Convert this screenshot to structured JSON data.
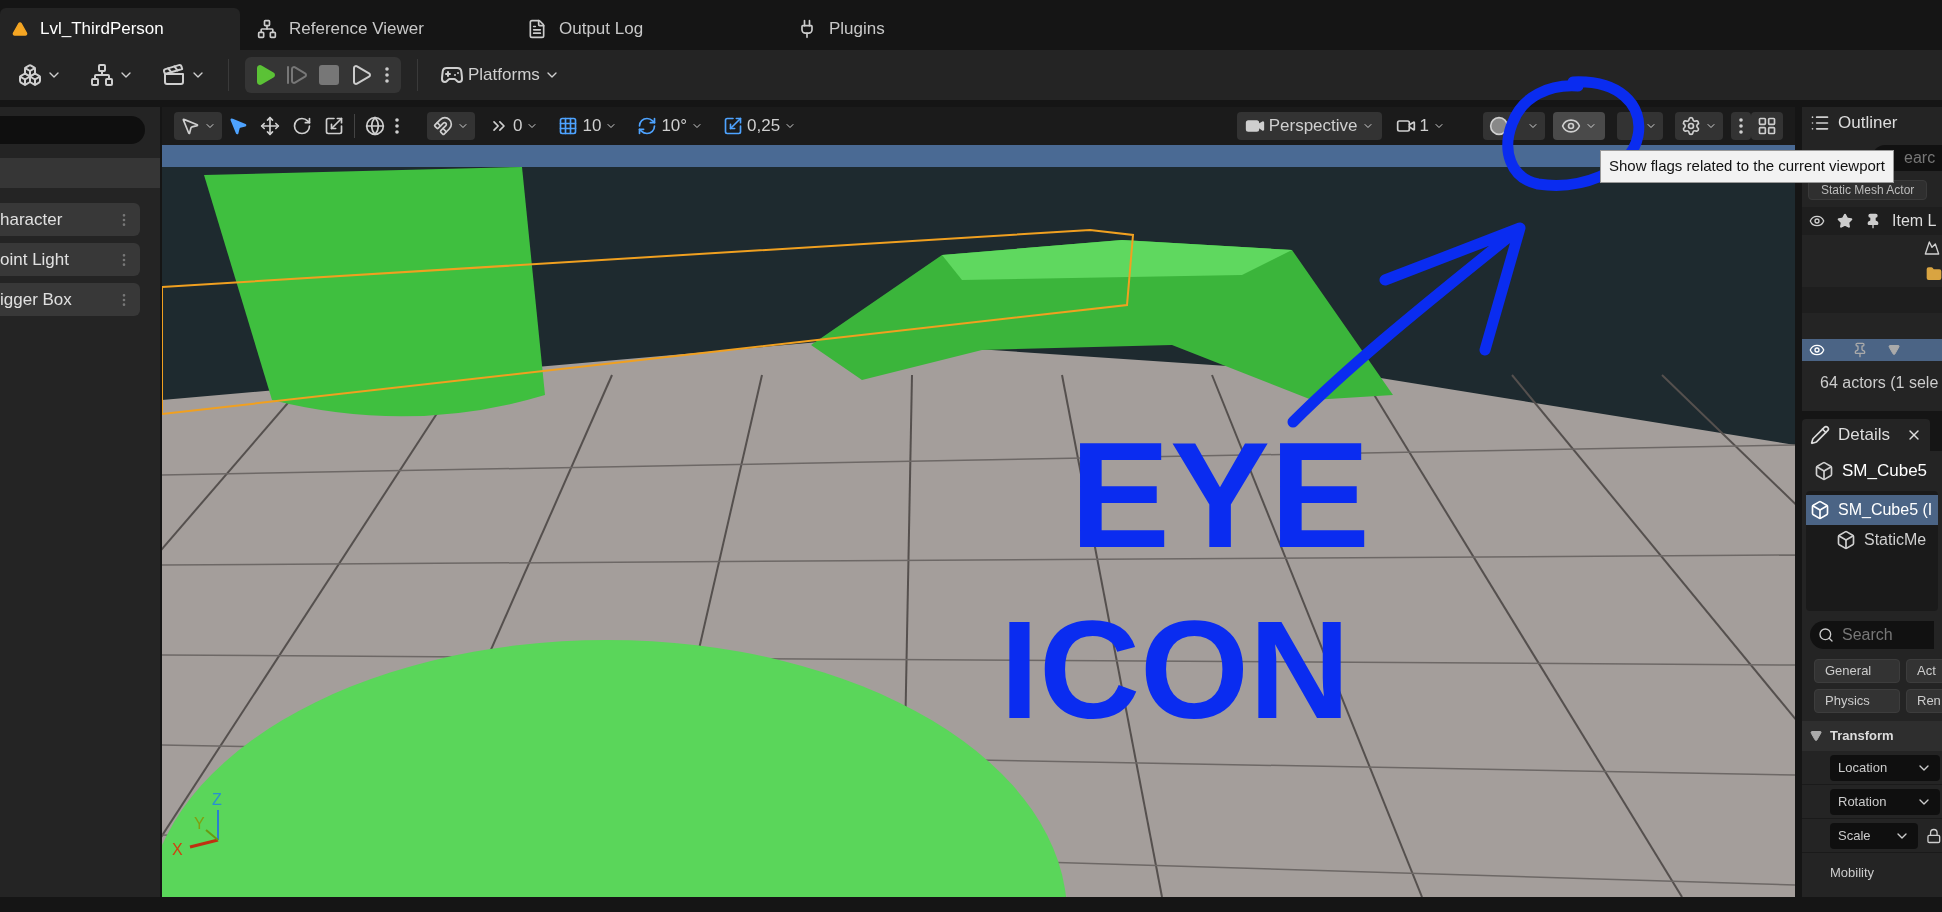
{
  "tabs": [
    {
      "label": "Lvl_ThirdPerson",
      "selected": true
    },
    {
      "label": "Reference Viewer",
      "selected": false
    },
    {
      "label": "Output Log",
      "selected": false
    },
    {
      "label": "Plugins",
      "selected": false
    }
  ],
  "toolbar": {
    "platforms": "Platforms"
  },
  "place_actors": {
    "items": [
      {
        "label": "haracter"
      },
      {
        "label": "oint Light"
      },
      {
        "label": "igger Box"
      }
    ]
  },
  "viewport": {
    "toolbar": {
      "surface_snap": "0",
      "grid_snap": "10",
      "rotation_snap": "10°",
      "scale_snap": "0,25",
      "view": "Perspective",
      "camera_speed": "1"
    },
    "show_flags_tooltip": "Show flags related to the current viewport",
    "axes": [
      "X",
      "Y",
      "Z"
    ]
  },
  "outliner": {
    "title": "Outliner",
    "search_placeholder": "earc",
    "filter": "Static Mesh Actor",
    "column": "Item L",
    "status": "64 actors (1 sele"
  },
  "details": {
    "title": "Details",
    "actor": "SM_Cube5",
    "components": [
      {
        "label": "SM_Cube5 (I",
        "selected": true,
        "children": [
          {
            "label": "StaticMe",
            "selected": false
          }
        ]
      }
    ],
    "search_placeholder": "Search",
    "filters": [
      "General",
      "Act",
      "Physics",
      "Ren"
    ],
    "section": "Transform",
    "properties": [
      "Location",
      "Rotation",
      "Scale"
    ],
    "mobility": "Mobility"
  },
  "annotation": {
    "lines": [
      "EYE",
      "ICON"
    ]
  }
}
